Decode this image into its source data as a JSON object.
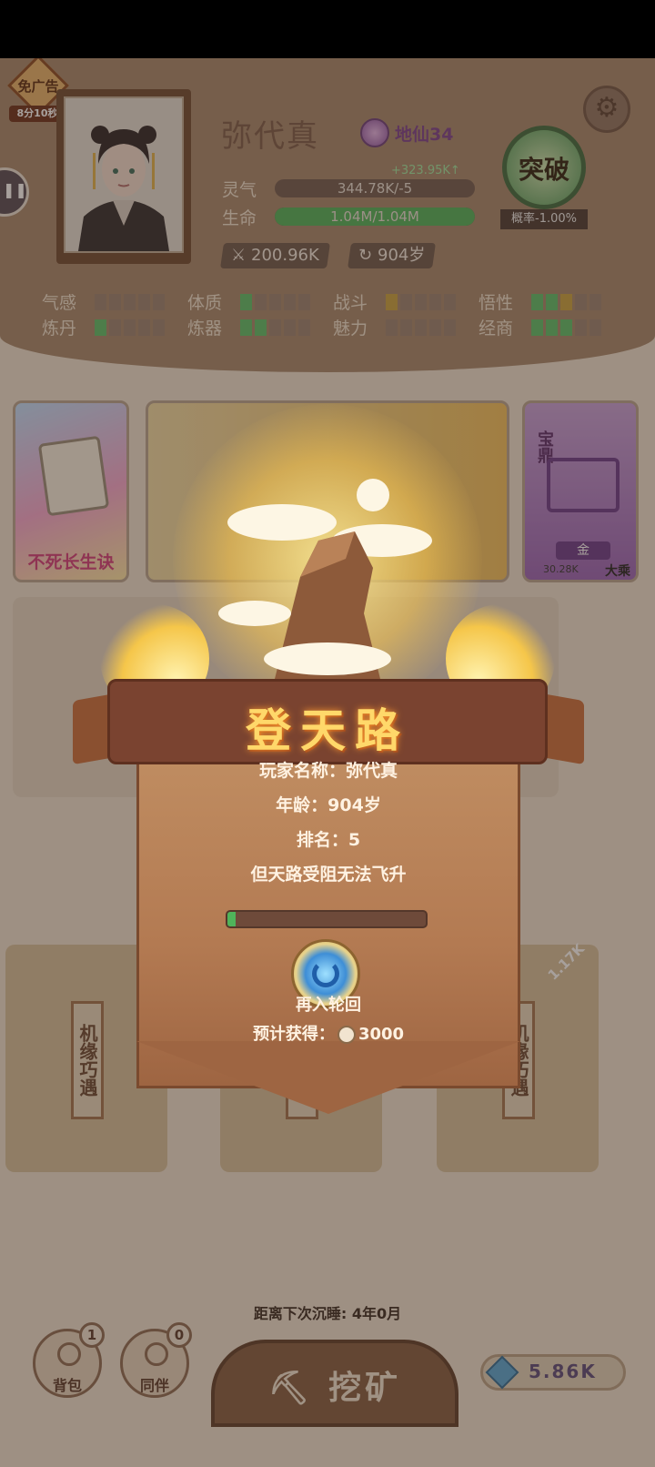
{
  "header": {
    "no_ad_label": "免广告",
    "no_ad_timer": "8分10秒",
    "player_name": "弥代真",
    "realm": "地仙34",
    "spirit_gain": "+323.95K↑",
    "spirit_label": "灵气",
    "spirit_value": "344.78K/-5",
    "life_label": "生命",
    "life_value": "1.04M/1.04M",
    "life_fraction": 1.0,
    "power_value": "200.96K",
    "age_value": "904岁",
    "breakthrough_label": "突破",
    "breakthrough_prob": "概率-1.00%"
  },
  "attributes": [
    {
      "label": "气感",
      "level": 0
    },
    {
      "label": "体质",
      "level": 1
    },
    {
      "label": "战斗",
      "level": 1
    },
    {
      "label": "悟性",
      "level": 3
    },
    {
      "label": "炼丹",
      "level": 1
    },
    {
      "label": "炼器",
      "level": 2
    },
    {
      "label": "魅力",
      "level": 0
    },
    {
      "label": "经商",
      "level": 3
    }
  ],
  "cards": {
    "main_card_label": "不死长生诀",
    "treasure_label": "宝鼎",
    "treasure_element": "金",
    "treasure_value": "30.28K",
    "treasure_rank": "大乘"
  },
  "bags": {
    "label": "机缘巧遇",
    "right_count": "1.17K"
  },
  "modal": {
    "title": "登天路",
    "player_line": "玩家名称：弥代真",
    "age_line": "年龄：904岁",
    "rank_line": "排名：5",
    "message": "但天路受阻无法飞升",
    "progress": 0.04,
    "reincarnate_label": "再入轮回",
    "expected_label": "预计获得：",
    "expected_value": "3000"
  },
  "footer": {
    "next_sleep": "距离下次沉睡: 4年0月",
    "backpack_label": "背包",
    "backpack_count": "1",
    "companion_label": "同伴",
    "companion_count": "0",
    "mine_label": "挖矿",
    "gem_count": "5.86K"
  },
  "colors": {
    "header_bg": "#a7876c",
    "life_bar": "#4fb35a",
    "modal_title": "#ffd86a",
    "pip_green": "#5bbf6a",
    "pip_gold": "#c9a23e"
  }
}
